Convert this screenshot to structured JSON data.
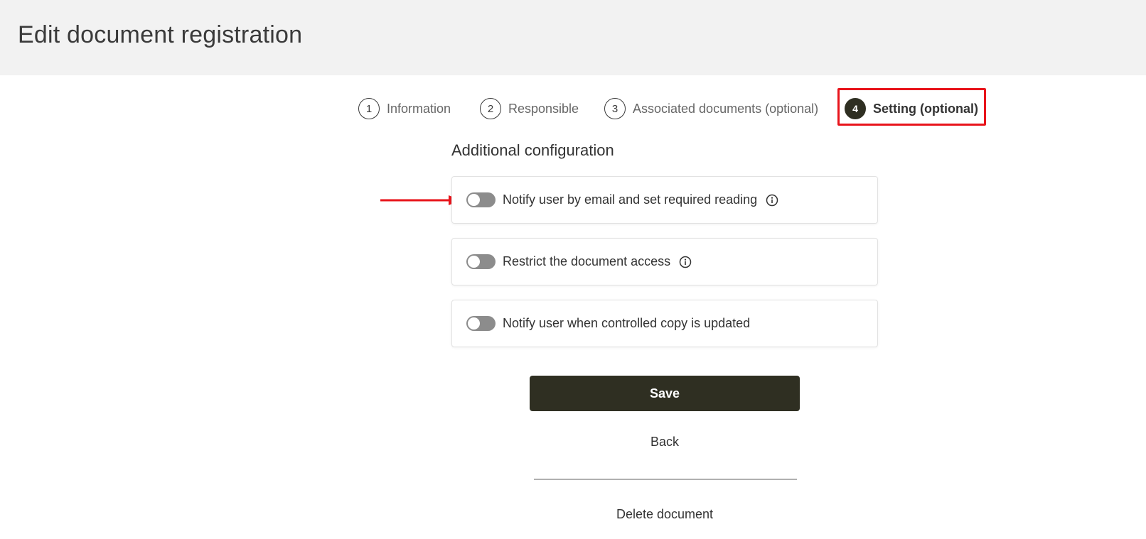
{
  "header": {
    "title": "Edit document registration"
  },
  "stepper": {
    "steps": [
      {
        "number": "1",
        "label": "Information",
        "active": false
      },
      {
        "number": "2",
        "label": "Responsible",
        "active": false
      },
      {
        "number": "3",
        "label": "Associated documents (optional)",
        "active": false
      },
      {
        "number": "4",
        "label": "Setting (optional)",
        "active": true
      }
    ]
  },
  "section": {
    "title": "Additional configuration"
  },
  "options": [
    {
      "label": "Notify user by email and set required reading",
      "enabled": false,
      "has_info_icon": true
    },
    {
      "label": "Restrict the document access",
      "enabled": false,
      "has_info_icon": true
    },
    {
      "label": "Notify user when controlled copy is updated",
      "enabled": false,
      "has_info_icon": false
    }
  ],
  "actions": {
    "save_label": "Save",
    "back_label": "Back",
    "delete_label": "Delete document"
  },
  "colors": {
    "header_bg": "#f2f2f2",
    "primary_dark": "#2f2f22",
    "toggle_off": "#8c8c8c",
    "annotation_red": "#e8141b"
  },
  "icons": {
    "info": "info-circle-icon",
    "annotation_arrow": "arrow-right-icon"
  }
}
